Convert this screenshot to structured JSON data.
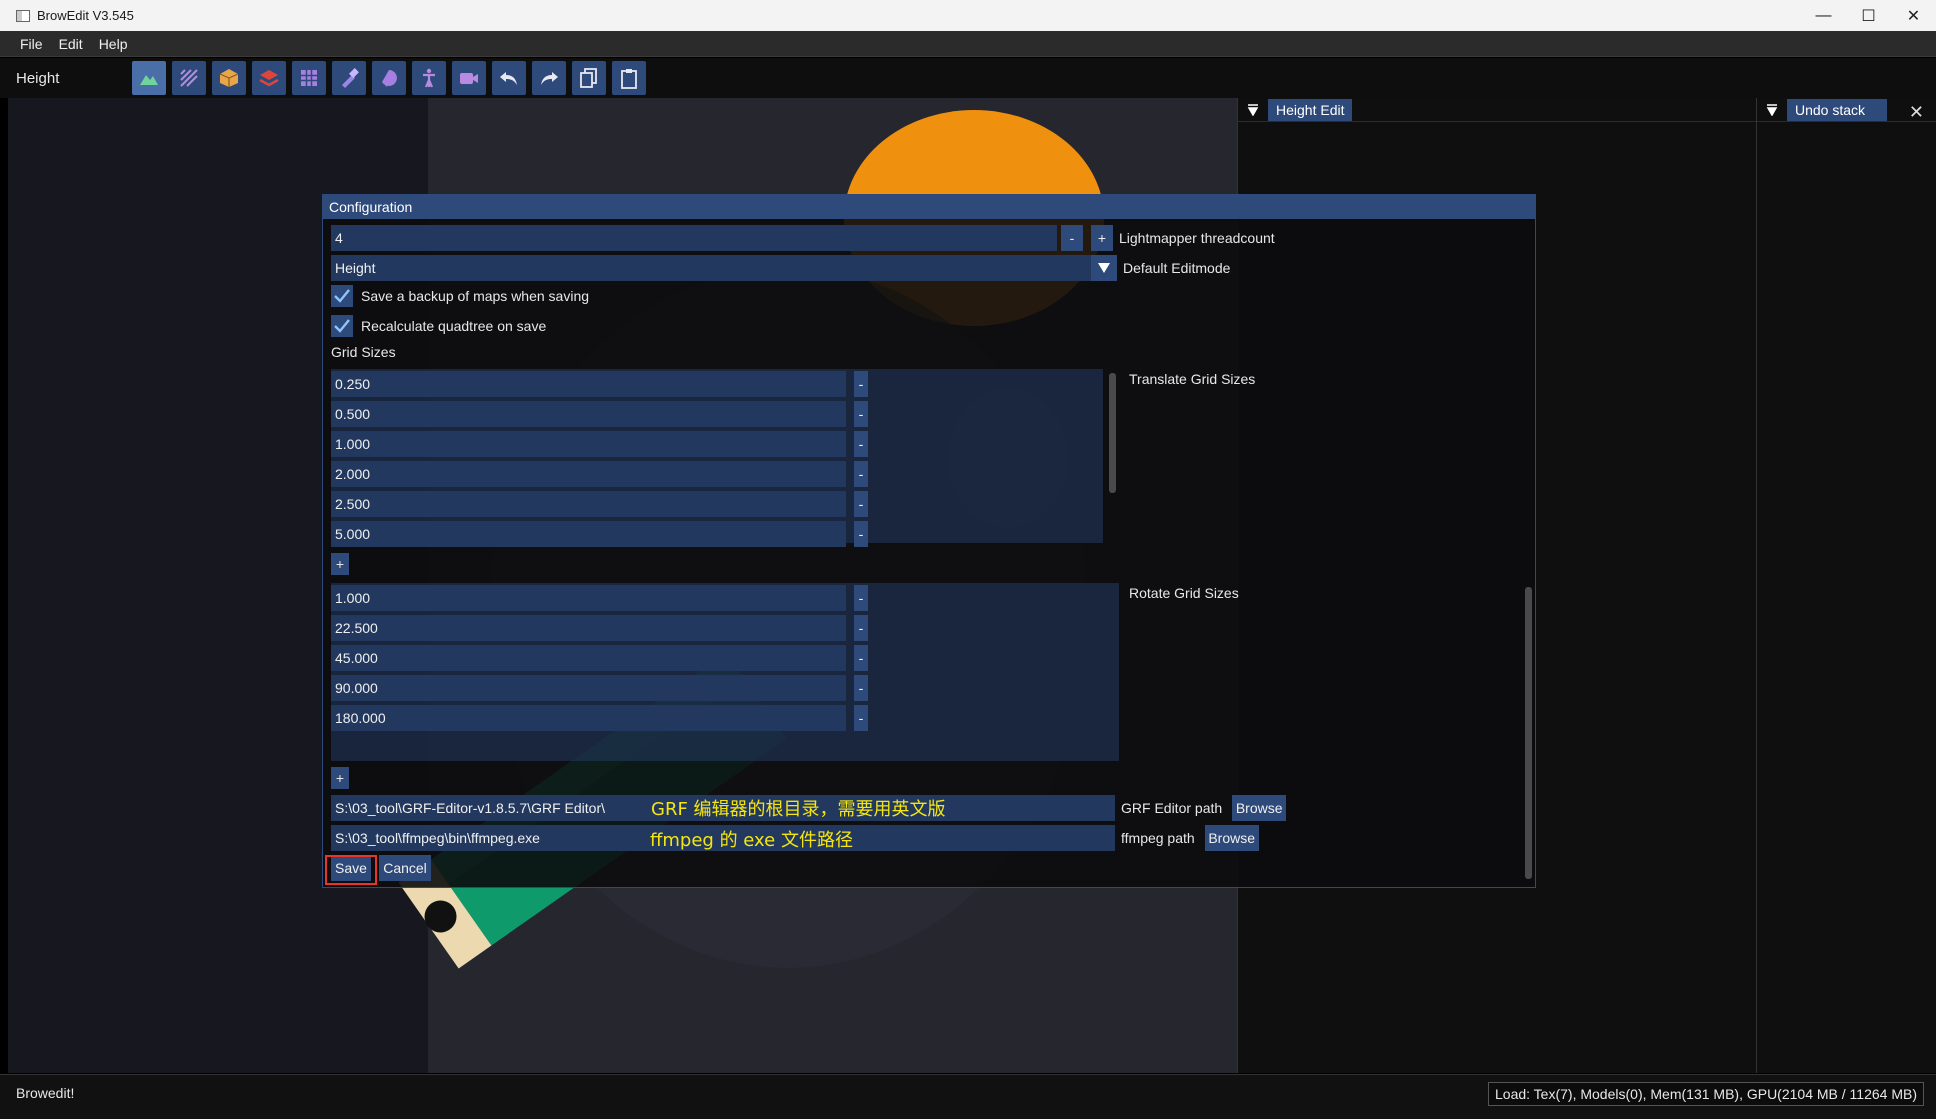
{
  "window": {
    "title": "BrowEdit V3.545"
  },
  "menu": [
    "File",
    "Edit",
    "Help"
  ],
  "toolbar": {
    "mode_label": "Height",
    "buttons": [
      "height-icon",
      "texture-icon",
      "object-icon",
      "wall-icon",
      "gat-icon",
      "paint-icon",
      "sphere-icon",
      "tools-icon",
      "camera-icon",
      "undo-icon",
      "redo-icon",
      "copy-icon",
      "paste-icon"
    ]
  },
  "panels": {
    "height_edit": "Height Edit",
    "undo_stack": "Undo stack"
  },
  "dialog": {
    "title": "Configuration",
    "threadcount": {
      "value": "4",
      "minus": "-",
      "plus": "+",
      "label": "Lightmapper threadcount"
    },
    "editmode": {
      "value": "Height",
      "label": "Default Editmode"
    },
    "backup": {
      "label": "Save a backup of maps when saving",
      "checked": true
    },
    "quadtree": {
      "label": "Recalculate quadtree on save",
      "checked": true
    },
    "grid_sizes_label": "Grid Sizes",
    "translate": {
      "label": "Translate Grid Sizes",
      "values": [
        "0.250",
        "0.500",
        "1.000",
        "2.000",
        "2.500",
        "5.000"
      ]
    },
    "rotate": {
      "label": "Rotate Grid Sizes",
      "values": [
        "1.000",
        "22.500",
        "45.000",
        "90.000",
        "180.000"
      ]
    },
    "minus": "-",
    "plus": "+",
    "grf": {
      "value": "S:\\03_tool\\GRF-Editor-v1.8.5.7\\GRF Editor\\",
      "label": "GRF Editor path",
      "browse": "Browse",
      "note": "GRF 编辑器的根目录，需要用英文版"
    },
    "ffmpeg": {
      "value": "S:\\03_tool\\ffmpeg\\bin\\ffmpeg.exe",
      "label": "ffmpeg path",
      "browse": "Browse",
      "note": "ffmpeg 的 exe 文件路径"
    },
    "save": "Save",
    "cancel": "Cancel"
  },
  "status": {
    "left": "Browedit!",
    "right": "Load: Tex(7), Models(0), Mem(131 MB), GPU(2104 MB / 11264 MB)"
  },
  "colors": {
    "accent": "#2e4a7a",
    "annotation": "#f5e60f",
    "highlight": "#e8342c"
  }
}
